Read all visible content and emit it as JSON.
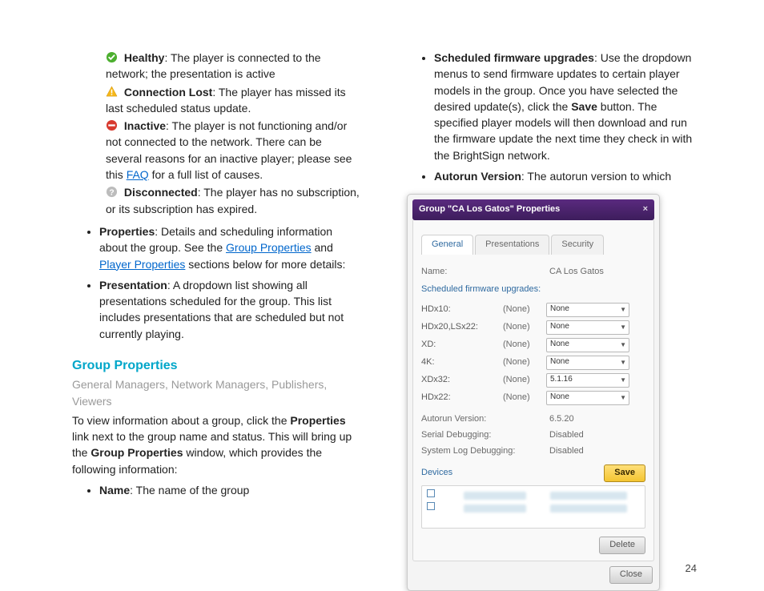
{
  "left": {
    "statuses": {
      "healthy_label": "Healthy",
      "healthy_text": ": The player is connected to the network; the presentation is active",
      "connlost_label": "Connection Lost",
      "connlost_text": ": The player has missed its last scheduled status update.",
      "inactive_label": "Inactive",
      "inactive_text_a": ": The player is not functioning and/or not connected to the network. There can be several reasons for an inactive player; please see this ",
      "inactive_link": "FAQ",
      "inactive_text_b": " for a full list of causes.",
      "disconnected_label": "Disconnected",
      "disconnected_text": ": The player has no subscription, or its subscription has expired."
    },
    "bullets": {
      "properties_label": "Properties",
      "properties_text_a": ": Details and scheduling information about the group. See the ",
      "properties_link1": "Group Properties",
      "properties_text_b": " and ",
      "properties_link2": "Player Properties",
      "properties_text_c": " sections below for more details:",
      "presentation_label": "Presentation",
      "presentation_text": ": A dropdown list showing all presentations scheduled for the group. This list includes presentations that are scheduled but not currently playing."
    },
    "section_heading": "Group Properties",
    "roles": "General Managers, Network Managers, Publishers, Viewers",
    "para_a": "To view information about a group, click the ",
    "para_bold": "Properties",
    "para_b": " link next to the group name and status. This will bring up the ",
    "para_bold2": "Group Properties",
    "para_c": " window, which provides the following information:",
    "name_label": "Name",
    "name_text": ": The name of the group"
  },
  "right": {
    "bullets": {
      "sfu_label": "Scheduled firmware upgrades",
      "sfu_text_a": ": Use the dropdown menus to send firmware updates to certain player models in the group. Once you have selected the desired update(s), click the ",
      "sfu_bold": "Save",
      "sfu_text_b": " button. The specified player models will then download and run the firmware update the next time they check in with the BrightSign network.",
      "autorun_label": "Autorun Version",
      "autorun_text": ": The autorun version to which"
    }
  },
  "dialog": {
    "title": "Group \"CA Los Gatos\" Properties",
    "tabs": {
      "general": "General",
      "presentations": "Presentations",
      "security": "Security"
    },
    "name_label": "Name:",
    "name_value": "CA Los Gatos",
    "sfu_header": "Scheduled firmware upgrades:",
    "rows": [
      {
        "model": "HDx10:",
        "cur": "(None)",
        "sel": "None"
      },
      {
        "model": "HDx20,LSx22:",
        "cur": "(None)",
        "sel": "None"
      },
      {
        "model": "XD:",
        "cur": "(None)",
        "sel": "None"
      },
      {
        "model": "4K:",
        "cur": "(None)",
        "sel": "None"
      },
      {
        "model": "XDx32:",
        "cur": "(None)",
        "sel": "5.1.16"
      },
      {
        "model": "HDx22:",
        "cur": "(None)",
        "sel": "None"
      }
    ],
    "autorun_label": "Autorun Version:",
    "autorun_value": "6.5.20",
    "serial_label": "Serial Debugging:",
    "serial_value": "Disabled",
    "syslog_label": "System Log Debugging:",
    "syslog_value": "Disabled",
    "devices_header": "Devices",
    "save_btn": "Save",
    "delete_btn": "Delete",
    "close_btn": "Close"
  },
  "page_number": "24"
}
